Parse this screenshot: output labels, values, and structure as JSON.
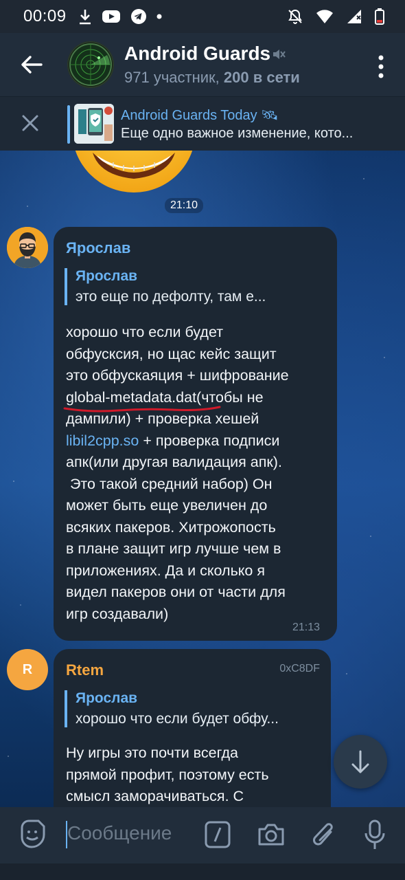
{
  "status_bar": {
    "time": "00:09"
  },
  "header": {
    "title": "Android Guards",
    "members": "971 участник, ",
    "online": "200 в сети"
  },
  "pinned": {
    "title": "Android Guards Today",
    "text": "Еще одно важное изменение, кото..."
  },
  "messages": [
    {
      "time": "21:10"
    },
    {
      "sender": "Ярослав",
      "reply_name": "Ярослав",
      "reply_text": "это еще по дефолту, там е...",
      "lines": [
        "хорошо что если будет",
        "обфусксия, но щас кейс защит",
        "это обфускаяция + шифрование",
        "global-metadata.dat",
        "(чтобы не",
        "дампили) + проверка хешей",
        "libil2cpp.so",
        " + проверка подписи",
        "апк(или другая валидация апк).",
        " Это такой средний набор) Он",
        "может быть еще увеличен до",
        "всяких пакеров. Хитрожопость",
        "в плане защит игр лучше чем в",
        "приложениях. Да и сколько я",
        "видел пакеров они от части для",
        "игр создавали)"
      ],
      "time": "21:13"
    },
    {
      "sender": "Rtem",
      "avatar_letter": "R",
      "tag": "0xC8DF",
      "reply_name": "Ярослав",
      "reply_text": "хорошо что если будет обфу...",
      "lines": [
        "Ну игры это почти всегда",
        "прямой профит, поэтому есть",
        "смысл заморачиваться. С"
      ]
    }
  ],
  "input": {
    "placeholder": "Сообщение"
  },
  "colors": {
    "accent": "#6ab3f3",
    "bubble": "#1c2733",
    "header": "#212d3b",
    "rtem_name": "#f5a640",
    "underline": "#d11a2a"
  }
}
